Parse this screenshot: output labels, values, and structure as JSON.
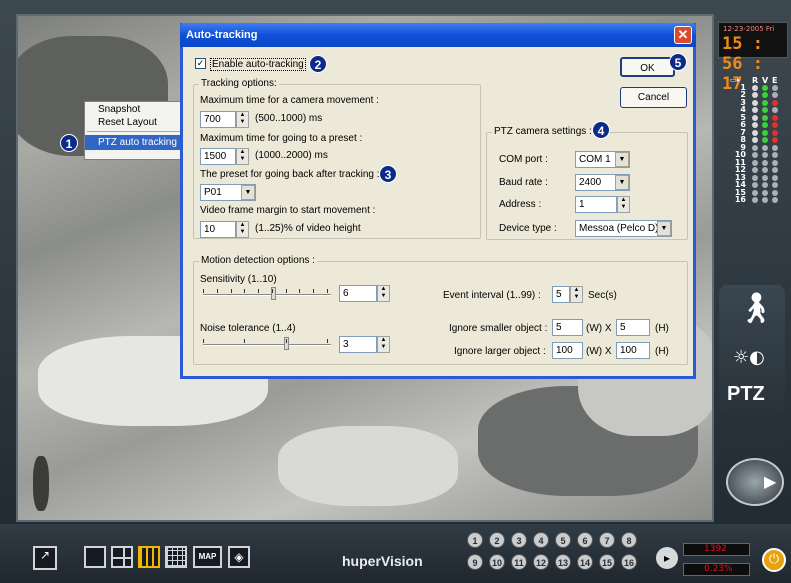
{
  "clock": {
    "date": "12-23-2005 Fri",
    "time": "15 : 56 : 17"
  },
  "context_menu": {
    "items": [
      "Snapshot",
      "Reset Layout",
      "PTZ auto tracking"
    ]
  },
  "dialog": {
    "title": "Auto-tracking",
    "close": "✕",
    "enable_label": "Enable auto-tracking",
    "enable_checked": true,
    "ok": "OK",
    "cancel": "Cancel",
    "tracking": {
      "group": "Tracking options:",
      "max_move_label": "Maximum time for a camera movement :",
      "max_move_value": "700",
      "max_move_range": "(500..1000) ms",
      "preset_time_label": "Maximum time for going to a preset :",
      "preset_time_value": "1500",
      "preset_time_range": "(1000..2000) ms",
      "preset_back_label": "The preset for going back after tracking :",
      "preset_back_value": "P01",
      "margin_label": "Video frame margin to start movement :",
      "margin_value": "10",
      "margin_range": "(1..25)% of video height"
    },
    "ptz": {
      "group": "PTZ camera settings :",
      "com_label": "COM port :",
      "com_value": "COM 1",
      "baud_label": "Baud rate :",
      "baud_value": "2400",
      "addr_label": "Address :",
      "addr_value": "1",
      "device_label": "Device type :",
      "device_value": "Messoa (Pelco D)"
    },
    "motion": {
      "group": "Motion detection options :",
      "sens_label": "Sensitivity (1..10)",
      "sens_value": "6",
      "sens_level": 0.55,
      "noise_label": "Noise tolerance (1..4)",
      "noise_value": "3",
      "noise_level": 0.66,
      "event_label": "Event interval (1..99) :",
      "event_value": "5",
      "event_unit": "Sec(s)",
      "smaller_label": "Ignore smaller object :",
      "smaller_w": "5",
      "smaller_h": "5",
      "larger_label": "Ignore larger object :",
      "larger_w": "100",
      "larger_h": "100",
      "w_unit": "(W) X",
      "h_unit": "(H)"
    }
  },
  "badges": [
    "1",
    "2",
    "3",
    "4",
    "5"
  ],
  "led_header": [
    "R",
    "V",
    "E"
  ],
  "channels": [
    "1",
    "2",
    "3",
    "4",
    "5",
    "6",
    "7",
    "8",
    "9",
    "10",
    "11",
    "12",
    "13",
    "14",
    "15",
    "16"
  ],
  "side": {
    "ptz": "PTZ"
  },
  "bottom": {
    "brand": "huperVision",
    "map": "MAP",
    "cams_row1": [
      "1",
      "2",
      "3",
      "4",
      "5",
      "6",
      "7",
      "8"
    ],
    "cams_row2": [
      "9",
      "10",
      "11",
      "12",
      "13",
      "14",
      "15",
      "16"
    ],
    "disk1": "1392",
    "disk2": "0.23%"
  }
}
